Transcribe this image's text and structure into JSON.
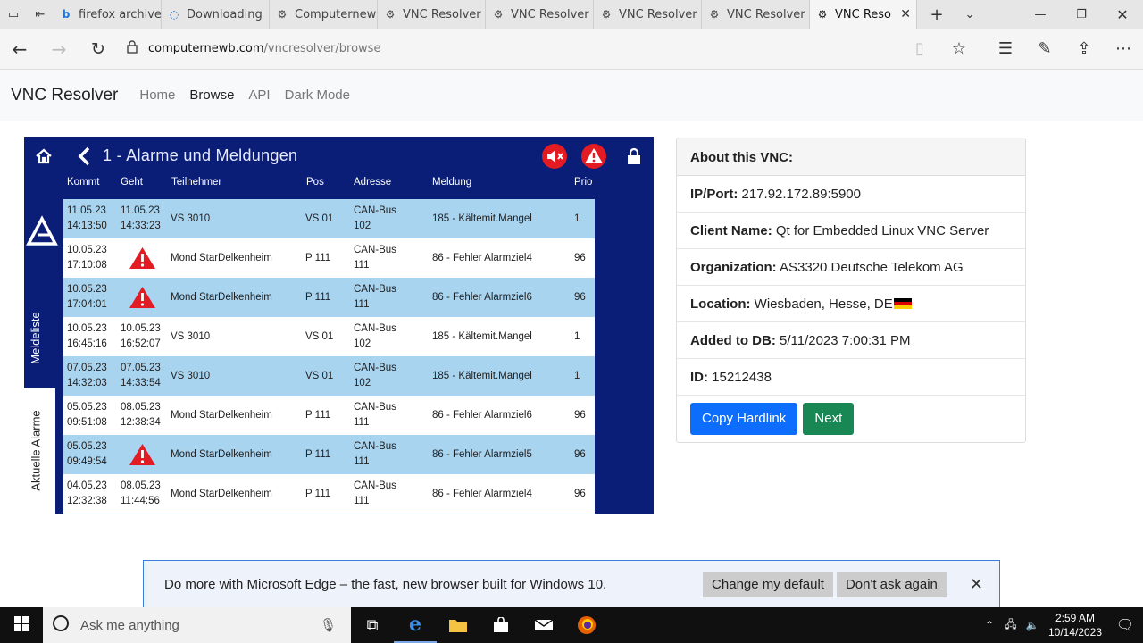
{
  "tabs": [
    {
      "label": "firefox archive",
      "icon": "bing-icon"
    },
    {
      "label": "Downloading",
      "icon": "edge-loading-icon"
    },
    {
      "label": "Computernew",
      "icon": "vnc-site-icon"
    },
    {
      "label": "VNC Resolver",
      "icon": "vnc-site-icon"
    },
    {
      "label": "VNC Resolver",
      "icon": "vnc-site-icon"
    },
    {
      "label": "VNC Resolver",
      "icon": "vnc-site-icon"
    },
    {
      "label": "VNC Resolver",
      "icon": "vnc-site-icon"
    },
    {
      "label": "VNC Reso",
      "icon": "vnc-site-icon",
      "active": true
    }
  ],
  "address": {
    "host": "computernewb.com",
    "path": "/vncresolver/browse"
  },
  "site": {
    "brand": "VNC Resolver",
    "nav": [
      "Home",
      "Browse",
      "API",
      "Dark Mode"
    ],
    "current": "Browse"
  },
  "vnc": {
    "title": "1 - Alarme und Meldungen",
    "side_top": "Meldeliste",
    "side_bottom": "Aktuelle Alarme",
    "columns": [
      "Kommt",
      "Geht",
      "Teilnehmer",
      "Pos",
      "Adresse",
      "Meldung",
      "Prio"
    ],
    "rows": [
      {
        "kommt": [
          "11.05.23",
          "14:13:50"
        ],
        "geht": [
          "11.05.23",
          "14:33:23"
        ],
        "teilnehmer": "VS 3010",
        "pos": "VS 01",
        "adresse": [
          "CAN-Bus",
          "102"
        ],
        "meldung": "185 - Kältemit.Mangel",
        "prio": "1",
        "style": "b"
      },
      {
        "kommt": [
          "10.05.23",
          "17:10:08"
        ],
        "geht": null,
        "teilnehmer": "Mond StarDelkenheim",
        "pos": "P 111",
        "adresse": [
          "CAN-Bus",
          "111"
        ],
        "meldung": "86 - Fehler Alarmziel4",
        "prio": "96",
        "style": "w"
      },
      {
        "kommt": [
          "10.05.23",
          "17:04:01"
        ],
        "geht": null,
        "teilnehmer": "Mond StarDelkenheim",
        "pos": "P 111",
        "adresse": [
          "CAN-Bus",
          "111"
        ],
        "meldung": "86 - Fehler Alarmziel6",
        "prio": "96",
        "style": "b"
      },
      {
        "kommt": [
          "10.05.23",
          "16:45:16"
        ],
        "geht": [
          "10.05.23",
          "16:52:07"
        ],
        "teilnehmer": "VS 3010",
        "pos": "VS 01",
        "adresse": [
          "CAN-Bus",
          "102"
        ],
        "meldung": "185 - Kältemit.Mangel",
        "prio": "1",
        "style": "w"
      },
      {
        "kommt": [
          "07.05.23",
          "14:32:03"
        ],
        "geht": [
          "07.05.23",
          "14:33:54"
        ],
        "teilnehmer": "VS 3010",
        "pos": "VS 01",
        "adresse": [
          "CAN-Bus",
          "102"
        ],
        "meldung": "185 - Kältemit.Mangel",
        "prio": "1",
        "style": "b"
      },
      {
        "kommt": [
          "05.05.23",
          "09:51:08"
        ],
        "geht": [
          "08.05.23",
          "12:38:34"
        ],
        "teilnehmer": "Mond StarDelkenheim",
        "pos": "P 111",
        "adresse": [
          "CAN-Bus",
          "111"
        ],
        "meldung": "86 - Fehler Alarmziel6",
        "prio": "96",
        "style": "w"
      },
      {
        "kommt": [
          "05.05.23",
          "09:49:54"
        ],
        "geht": null,
        "teilnehmer": "Mond StarDelkenheim",
        "pos": "P 111",
        "adresse": [
          "CAN-Bus",
          "111"
        ],
        "meldung": "86 - Fehler Alarmziel5",
        "prio": "96",
        "style": "b"
      },
      {
        "kommt": [
          "04.05.23",
          "12:32:38"
        ],
        "geht": [
          "08.05.23",
          "11:44:56"
        ],
        "teilnehmer": "Mond StarDelkenheim",
        "pos": "P 111",
        "adresse": [
          "CAN-Bus",
          "111"
        ],
        "meldung": "86 - Fehler Alarmziel4",
        "prio": "96",
        "style": "w"
      }
    ]
  },
  "about": {
    "heading": "About this VNC:",
    "fields": [
      {
        "label": "IP/Port:",
        "value": "217.92.172.89:5900"
      },
      {
        "label": "Client Name:",
        "value": "Qt for Embedded Linux VNC Server"
      },
      {
        "label": "Organization:",
        "value": "AS3320 Deutsche Telekom AG"
      },
      {
        "label": "Location:",
        "value": "Wiesbaden, Hesse, DE"
      },
      {
        "label": "Added to DB:",
        "value": "5/11/2023 7:00:31 PM"
      },
      {
        "label": "ID:",
        "value": "15212438"
      }
    ],
    "copy_button": "Copy Hardlink",
    "next_button": "Next"
  },
  "banner": {
    "text": "Do more with Microsoft Edge – the fast, new browser built for Windows 10.",
    "change": "Change my default",
    "dont": "Don't ask again"
  },
  "taskbar": {
    "search_placeholder": "Ask me anything",
    "time": "2:59 AM",
    "date": "10/14/2023"
  },
  "colors": {
    "vnc_bg": "#0a1e78",
    "row_blue": "#a8d4f0",
    "btn_blue": "#0d6efd",
    "btn_green": "#198754"
  }
}
